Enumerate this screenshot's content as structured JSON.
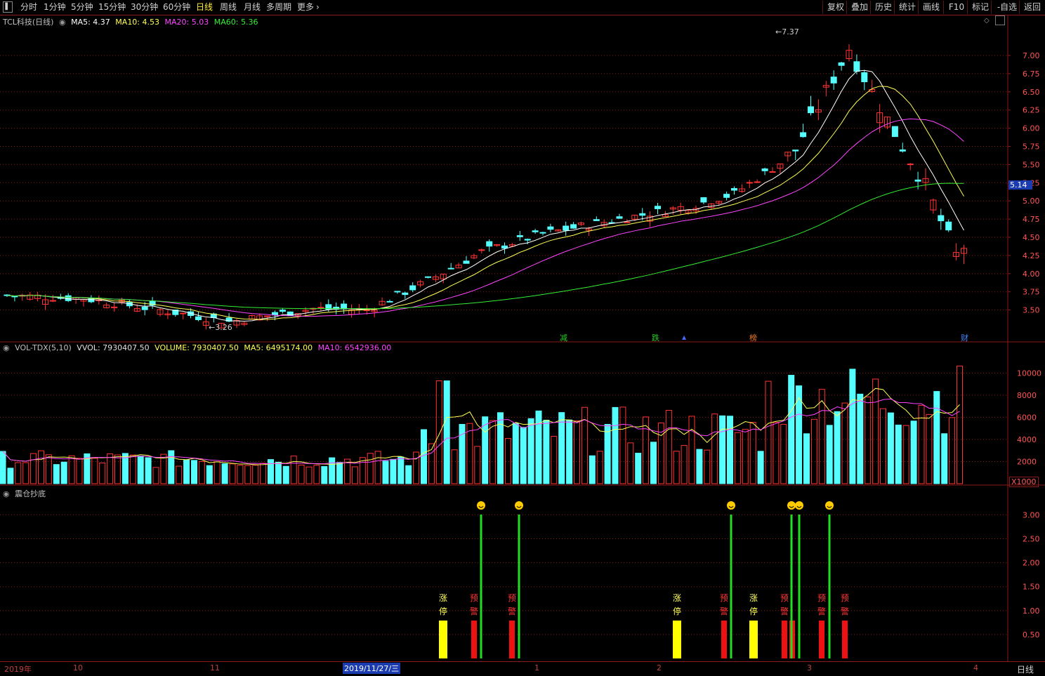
{
  "toolbar": {
    "periods": [
      {
        "label": "分时"
      },
      {
        "label": "1分钟"
      },
      {
        "label": "5分钟"
      },
      {
        "label": "15分钟"
      },
      {
        "label": "30分钟"
      },
      {
        "label": "60分钟"
      },
      {
        "label": "日线"
      },
      {
        "label": "周线"
      },
      {
        "label": "月线"
      },
      {
        "label": "多周期"
      },
      {
        "label": "更多"
      }
    ],
    "active_period": "日线",
    "right_buttons": [
      {
        "label": "复权"
      },
      {
        "label": "叠加"
      },
      {
        "label": "历史"
      },
      {
        "label": "统计"
      },
      {
        "label": "画线"
      },
      {
        "label": "F10"
      },
      {
        "label": "标记"
      },
      {
        "label": "-自选"
      },
      {
        "label": "返回"
      }
    ]
  },
  "price_panel": {
    "stock": "TCL科技(日线)",
    "ma": [
      {
        "label": "MA5: 4.37",
        "color": "#ffffff"
      },
      {
        "label": "MA10: 4.53",
        "color": "#ffff55"
      },
      {
        "label": "MA20: 5.03",
        "color": "#ff44ff"
      },
      {
        "label": "MA60: 5.36",
        "color": "#33ee33"
      }
    ],
    "axis_ticks": [
      "7.00",
      "6.75",
      "6.50",
      "6.25",
      "6.00",
      "5.75",
      "5.50",
      "5.25",
      "5.00",
      "4.75",
      "4.50",
      "4.25",
      "4.00",
      "3.75",
      "3.50"
    ],
    "current_price": "5.14",
    "high_label": "7.37",
    "low_label": "3.26",
    "markers": [
      {
        "text": "减",
        "color": "#22cc22"
      },
      {
        "text": "跌",
        "color": "#22cc22"
      },
      {
        "text": "▲",
        "color": "#4466ff"
      },
      {
        "text": "榜",
        "color": "#ee7722"
      },
      {
        "text": "财",
        "color": "#4488ff"
      }
    ]
  },
  "volume_panel": {
    "legend": [
      {
        "label": "VOL-TDX(5,10)",
        "color": "#c0c0c0"
      },
      {
        "label": "VVOL: 7930407.50",
        "color": "#e0e0e0"
      },
      {
        "label": "VOLUME: 7930407.50",
        "color": "#ffff55"
      },
      {
        "label": "MA5: 6495174.00",
        "color": "#ffff55"
      },
      {
        "label": "MA10: 6542936.00",
        "color": "#ff44ff"
      }
    ],
    "axis_ticks": [
      "10000",
      "8000",
      "6000",
      "4000",
      "2000"
    ],
    "unit": "X1000"
  },
  "indicator_panel": {
    "name": "震仓抄底",
    "axis_ticks": [
      "3.00",
      "2.50",
      "2.00",
      "1.50",
      "1.00",
      "0.50"
    ],
    "label_limit_up_1": "涨",
    "label_limit_up_2": "停",
    "label_warning_1": "预",
    "label_warning_2": "警",
    "smile": "☺"
  },
  "date_axis": {
    "labels": [
      "2019年",
      "10",
      "11",
      "2019/11/27/三",
      "1",
      "2",
      "3",
      "4"
    ],
    "period": "日线"
  },
  "colors": {
    "up": "#ff3333",
    "down": "#55ffff",
    "grid": "#8b1a1a",
    "axis_text": "#ff5555"
  }
}
